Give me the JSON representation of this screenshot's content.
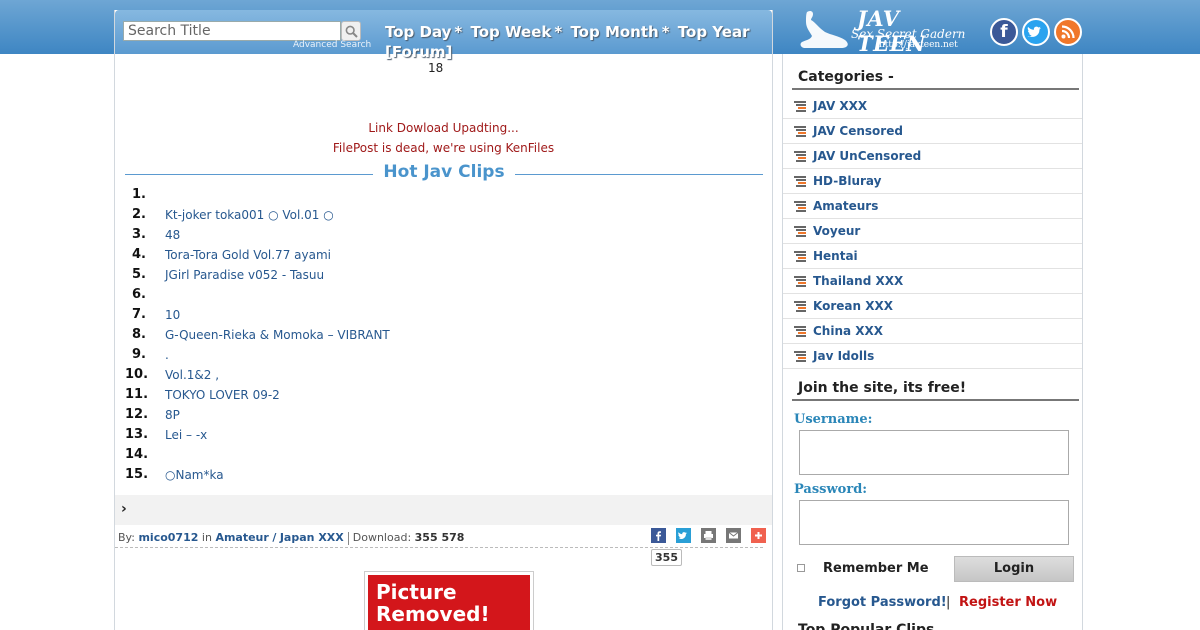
{
  "search": {
    "placeholder": "Search Title",
    "advanced": "Advanced Search"
  },
  "nav": {
    "items": [
      "Top Day",
      "Top Week",
      "Top Month",
      "Top Year",
      "[Forum]"
    ],
    "separator": "*"
  },
  "misc_number": "18",
  "notices": [
    "Link Dowload Upadting...",
    "FilePost is dead, we're using KenFiles"
  ],
  "hot_clips": {
    "title": "Hot Jav Clips",
    "items": [
      {
        "num": "1.",
        "title": ""
      },
      {
        "num": "2.",
        "title": "Kt-joker toka001 ○ Vol.01 ○"
      },
      {
        "num": "3.",
        "title": "48"
      },
      {
        "num": "4.",
        "title": "Tora-Tora Gold Vol.77 ayami"
      },
      {
        "num": "5.",
        "title": "JGirl Paradise v052 - Tasuu"
      },
      {
        "num": "6.",
        "title": ""
      },
      {
        "num": "7.",
        "title": "10"
      },
      {
        "num": "8.",
        "title": "G-Queen-Rieka & Momoka – VIBRANT"
      },
      {
        "num": "9.",
        "title": "."
      },
      {
        "num": "10.",
        "title": "Vol.1&2 ,"
      },
      {
        "num": "11.",
        "title": "TOKYO LOVER 09-2"
      },
      {
        "num": "12.",
        "title": "8P"
      },
      {
        "num": "13.",
        "title": "Lei  – -x"
      },
      {
        "num": "14.",
        "title": ""
      },
      {
        "num": "15.",
        "title": "○Nam*ka"
      }
    ]
  },
  "post_meta": {
    "by_label": "By:",
    "author": "mico0712",
    "in_label": "in",
    "category": "Amateur",
    "slash": "/",
    "subcategory": "Japan XXX",
    "download_label": "Download:",
    "download_count": "355 578",
    "share_count": "355"
  },
  "picture": {
    "line1": "Picture",
    "line2": "Removed!"
  },
  "logo": {
    "main": "JAV TEEN",
    "sub": "Sex Secret Gadern",
    "url": "http://javteen.net"
  },
  "social_icons": [
    "facebook-icon",
    "twitter-icon",
    "rss-icon"
  ],
  "sidebar": {
    "categories_title": "Categories -",
    "categories": [
      "JAV XXX",
      "JAV Censored",
      "JAV UnCensored",
      "HD-Bluray",
      "Amateurs",
      "Voyeur",
      "Hentai",
      "Thailand XXX",
      "Korean XXX",
      "China XXX",
      "Jav Idolls"
    ],
    "join_title": "Join the site, its free!",
    "username_label": "Username:",
    "password_label": "Password:",
    "remember_label": "Remember Me",
    "login_label": "Login",
    "forgot_label": "Forgot Password!",
    "pipe": "|",
    "register_label": "Register Now",
    "popular_title": "Top Popular Clips"
  },
  "colors": {
    "link": "#27588f",
    "notice": "#a01a1a",
    "header_blue": "#3e86c3",
    "register": "#c21414"
  }
}
